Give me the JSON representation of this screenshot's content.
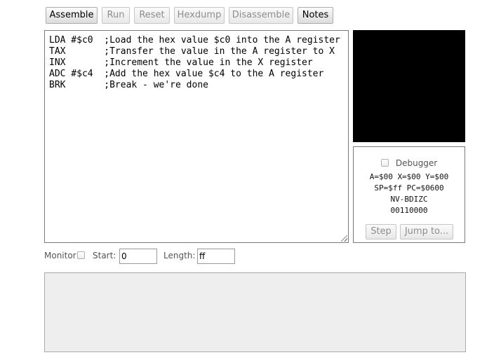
{
  "toolbar": {
    "assemble": "Assemble",
    "run": "Run",
    "reset": "Reset",
    "hexdump": "Hexdump",
    "disassemble": "Disassemble",
    "notes": "Notes"
  },
  "editor": {
    "lines": [
      "LDA #$c0  ;Load the hex value $c0 into the A register",
      "TAX       ;Transfer the value in the A register to X",
      "INX       ;Increment the value in the X register",
      "ADC #$c4  ;Add the hex value $c4 to the A register",
      "BRK       ;Break - we're done"
    ]
  },
  "debugger": {
    "label": "Debugger",
    "checked": false,
    "registers_line1": "A=$00 X=$00 Y=$00",
    "registers_line2": "SP=$ff PC=$0600",
    "flags_header": "NV-BDIZC",
    "flags_value": "00110000",
    "step": "Step",
    "jump_to": "Jump to..."
  },
  "monitor": {
    "label": "Monitor",
    "checked": false,
    "start_label": "Start: $",
    "start_value": "0",
    "length_label": "Length: $",
    "length_value": "ff"
  },
  "colors": {
    "screen_background": "#000000",
    "message_background": "#eeeeee"
  }
}
